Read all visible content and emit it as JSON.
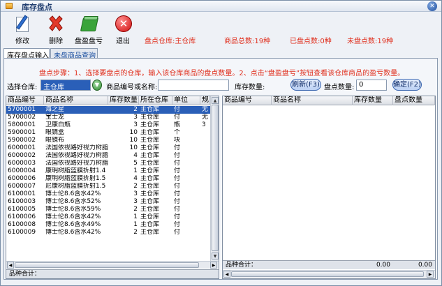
{
  "window": {
    "title": "库存盘点"
  },
  "toolbar": {
    "edit_label": "修改",
    "delete_label": "删除",
    "check_label": "盘盈盘亏",
    "exit_label": "退出"
  },
  "stats": {
    "warehouse": "盘点仓库:主仓库",
    "total": "商品总数:19种",
    "checked": "已盘点数:0种",
    "unchecked": "未盘点数:19种"
  },
  "tabs": [
    "库存盘点输入",
    "未盘商品查询"
  ],
  "steps_text": "盘点步骤：1、选择要盘点的仓库，输入该仓库商品的盘点数量。2、点击“盘盈盘亏”按钮查看该仓库商品的盈亏数量。",
  "filters": {
    "warehouse_label": "选择仓库:",
    "warehouse_value": "主仓库",
    "product_label": "商品编号或名称:",
    "product_value": "",
    "stock_label": "库存数量:",
    "refresh_label": "刷新(F3)",
    "count_label": "盘点数量:",
    "count_value": "0",
    "confirm_label": "确定(F2)"
  },
  "left_table": {
    "columns": [
      "商品编号",
      "商品名称",
      "库存数量",
      "所在仓库",
      "单位",
      "规"
    ],
    "rows": [
      [
        "5700001",
        "海之星",
        "2",
        "主仓库",
        "付",
        "无"
      ],
      [
        "5700002",
        "宝士龙",
        "3",
        "主仓库",
        "付",
        "无"
      ],
      [
        "5800001",
        "卫康白瓶",
        "3",
        "主仓库",
        "瓶",
        "3"
      ],
      [
        "5900001",
        "眼镜盒",
        "10",
        "主仓库",
        "个",
        ""
      ],
      [
        "5900002",
        "眼镜布",
        "10",
        "主仓库",
        "块",
        ""
      ],
      [
        "6000001",
        "法国依视路好视力树脂",
        "10",
        "主仓库",
        "付",
        ""
      ],
      [
        "6000002",
        "法国依视路好视力树脂",
        "4",
        "主仓库",
        "付",
        ""
      ],
      [
        "6000003",
        "法国依视路好视力树脂",
        "5",
        "主仓库",
        "付",
        ""
      ],
      [
        "6000004",
        "康明树脂蓝膜折射1.4",
        "1",
        "主仓库",
        "付",
        ""
      ],
      [
        "6000006",
        "康明树脂蓝膜折射1.5",
        "4",
        "主仓库",
        "付",
        ""
      ],
      [
        "6000007",
        "尼康树脂蓝膜折射1.5",
        "2",
        "主仓库",
        "付",
        ""
      ],
      [
        "6100001",
        "博士伦8.6含水42%",
        "3",
        "主仓库",
        "付",
        ""
      ],
      [
        "6100003",
        "博士伦8.6含水52%",
        "3",
        "主仓库",
        "付",
        ""
      ],
      [
        "6100005",
        "博士伦8.6含水59%",
        "2",
        "主仓库",
        "付",
        ""
      ],
      [
        "6100006",
        "博士伦8.6含水42%",
        "1",
        "主仓库",
        "付",
        ""
      ],
      [
        "6100008",
        "博士伦8.6含水49%",
        "1",
        "主仓库",
        "付",
        ""
      ],
      [
        "6100009",
        "博士伦8.6含水42%",
        "2",
        "主仓库",
        "付",
        ""
      ]
    ],
    "footer_label": "品种合计：",
    "footer_value": ""
  },
  "right_table": {
    "columns": [
      "商品编号",
      "商品名称",
      "库存数量",
      "盘点数量"
    ],
    "rows": [],
    "footer_label": "品种合计：",
    "footer_stock": "0.00",
    "footer_count": "0.00"
  }
}
